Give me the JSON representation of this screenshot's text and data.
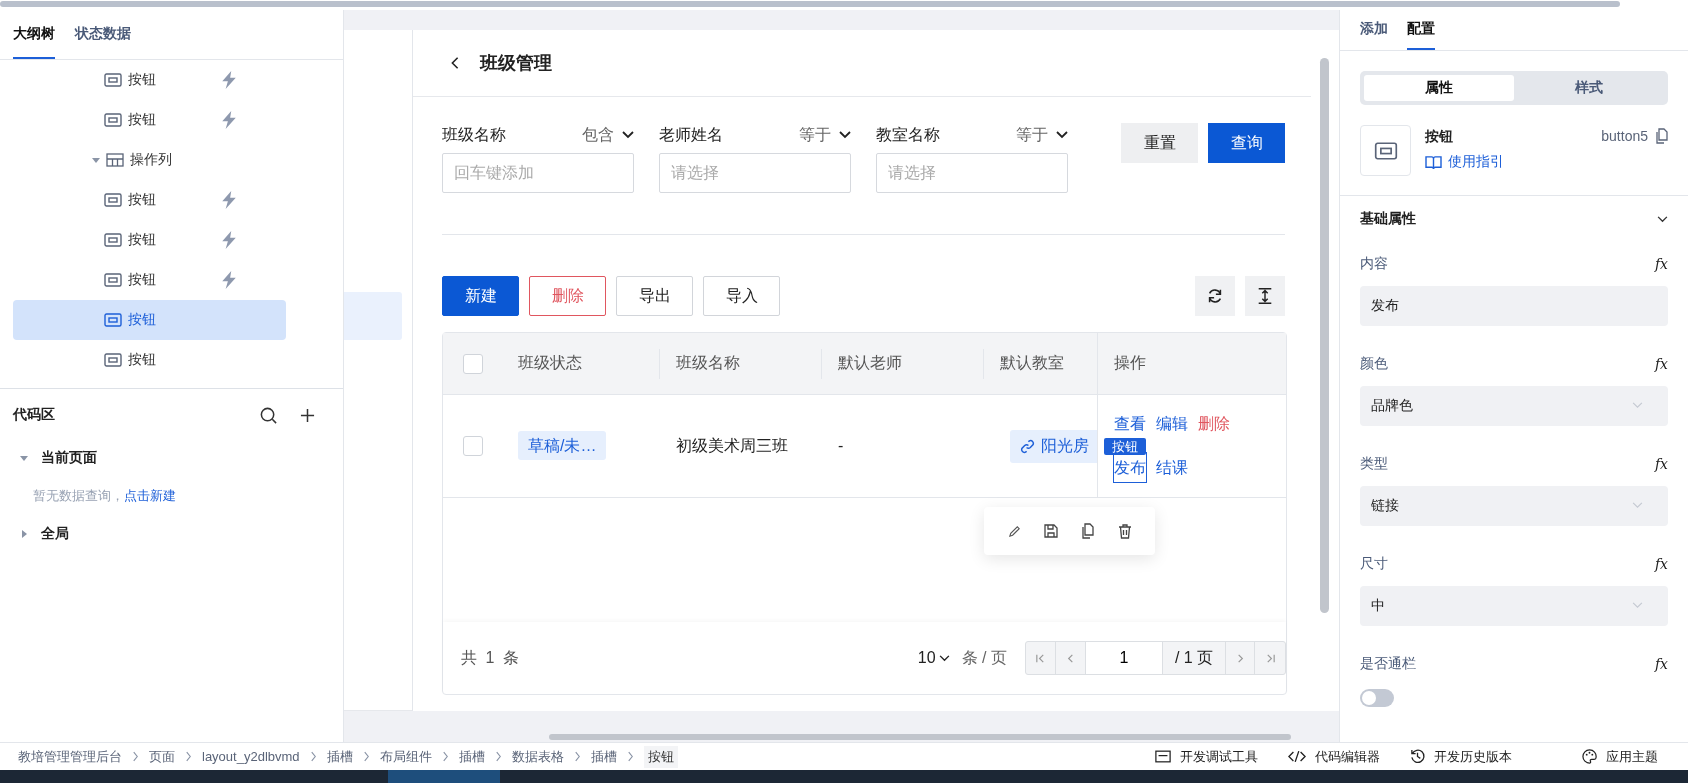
{
  "outline": {
    "tabs": [
      {
        "label": "大纲树",
        "selected": true
      },
      {
        "label": "状态数据",
        "selected": false
      }
    ],
    "tree": [
      {
        "label": "按钮",
        "kind": "button",
        "has_event": true,
        "selected": false
      },
      {
        "label": "按钮",
        "kind": "button",
        "has_event": true,
        "selected": false
      },
      {
        "label": "操作列",
        "kind": "column",
        "expanded": true,
        "selected": false,
        "children": [
          {
            "label": "按钮",
            "kind": "button",
            "has_event": true,
            "selected": false
          },
          {
            "label": "按钮",
            "kind": "button",
            "has_event": true,
            "selected": false
          },
          {
            "label": "按钮",
            "kind": "button",
            "has_event": true,
            "selected": false
          },
          {
            "label": "按钮",
            "kind": "button",
            "has_event": false,
            "selected": true
          },
          {
            "label": "按钮",
            "kind": "button",
            "has_event": false,
            "selected": false
          }
        ]
      }
    ]
  },
  "code_area": {
    "title": "代码区",
    "sections": [
      {
        "label": "当前页面",
        "expanded": true,
        "empty_text": "暂无数据查询，",
        "empty_link": "点击新建"
      },
      {
        "label": "全局",
        "expanded": false
      }
    ]
  },
  "page": {
    "title": "班级管理",
    "filters": [
      {
        "label": "班级名称",
        "operator": "包含",
        "placeholder": "回车键添加"
      },
      {
        "label": "老师姓名",
        "operator": "等于",
        "placeholder": "请选择"
      },
      {
        "label": "教室名称",
        "operator": "等于",
        "placeholder": "请选择"
      }
    ],
    "filter_buttons": [
      {
        "label": "重置",
        "kind": "default"
      },
      {
        "label": "查询",
        "kind": "primary"
      }
    ],
    "toolbar": [
      {
        "label": "新建",
        "kind": "primary"
      },
      {
        "label": "删除",
        "kind": "danger"
      },
      {
        "label": "导出",
        "kind": "default"
      },
      {
        "label": "导入",
        "kind": "default"
      }
    ],
    "table": {
      "header_checked": false,
      "columns": [
        "班级状态",
        "班级名称",
        "默认老师",
        "默认教室",
        "操作"
      ],
      "rows": [
        {
          "checked": false,
          "status": "草稿/未…",
          "name": "初级美术周三班",
          "teacher": "-",
          "classroom": "阳光房",
          "actions": [
            {
              "label": "查看",
              "kind": "link",
              "selected": false
            },
            {
              "label": "编辑",
              "kind": "link",
              "selected": false
            },
            {
              "label": "删除",
              "kind": "danger",
              "selected": false
            },
            {
              "label": "发布",
              "kind": "link",
              "selected": true
            },
            {
              "label": "结课",
              "kind": "link",
              "selected": false
            }
          ],
          "selection_badge": "按钮"
        }
      ]
    },
    "pagination": {
      "total": "共 1 条",
      "page_size": "10",
      "page_size_unit": "条 / 页",
      "current_page": "1",
      "page_total": "/ 1 页"
    }
  },
  "config": {
    "tabs": [
      {
        "label": "添加",
        "selected": false
      },
      {
        "label": "配置",
        "selected": true
      }
    ],
    "segments": [
      {
        "label": "属性",
        "selected": true
      },
      {
        "label": "样式",
        "selected": false
      }
    ],
    "component": {
      "name": "按钮",
      "guide": "使用指引",
      "id": "button5"
    },
    "section": "基础属性",
    "fields": [
      {
        "label": "内容",
        "kind": "input",
        "value": "发布",
        "formula": "fx"
      },
      {
        "label": "颜色",
        "kind": "select",
        "value": "品牌色",
        "formula": "fx"
      },
      {
        "label": "类型",
        "kind": "select",
        "value": "链接",
        "formula": "fx"
      },
      {
        "label": "尺寸",
        "kind": "select",
        "value": "中",
        "formula": "fx"
      },
      {
        "label": "是否通栏",
        "kind": "switch",
        "on": false,
        "formula": "fx"
      }
    ]
  },
  "status_bar": {
    "breadcrumbs": [
      "教培管理管理后台",
      "页面",
      "layout_y2dlbvmd",
      "插槽",
      "布局组件",
      "插槽",
      "数据表格",
      "插槽",
      "按钮"
    ],
    "tools": [
      {
        "label": "开发调试工具",
        "kind": "debug"
      },
      {
        "label": "代码编辑器",
        "kind": "code"
      },
      {
        "label": "开发历史版本",
        "kind": "history"
      },
      {
        "label": "应用主题",
        "kind": "theme"
      }
    ]
  }
}
